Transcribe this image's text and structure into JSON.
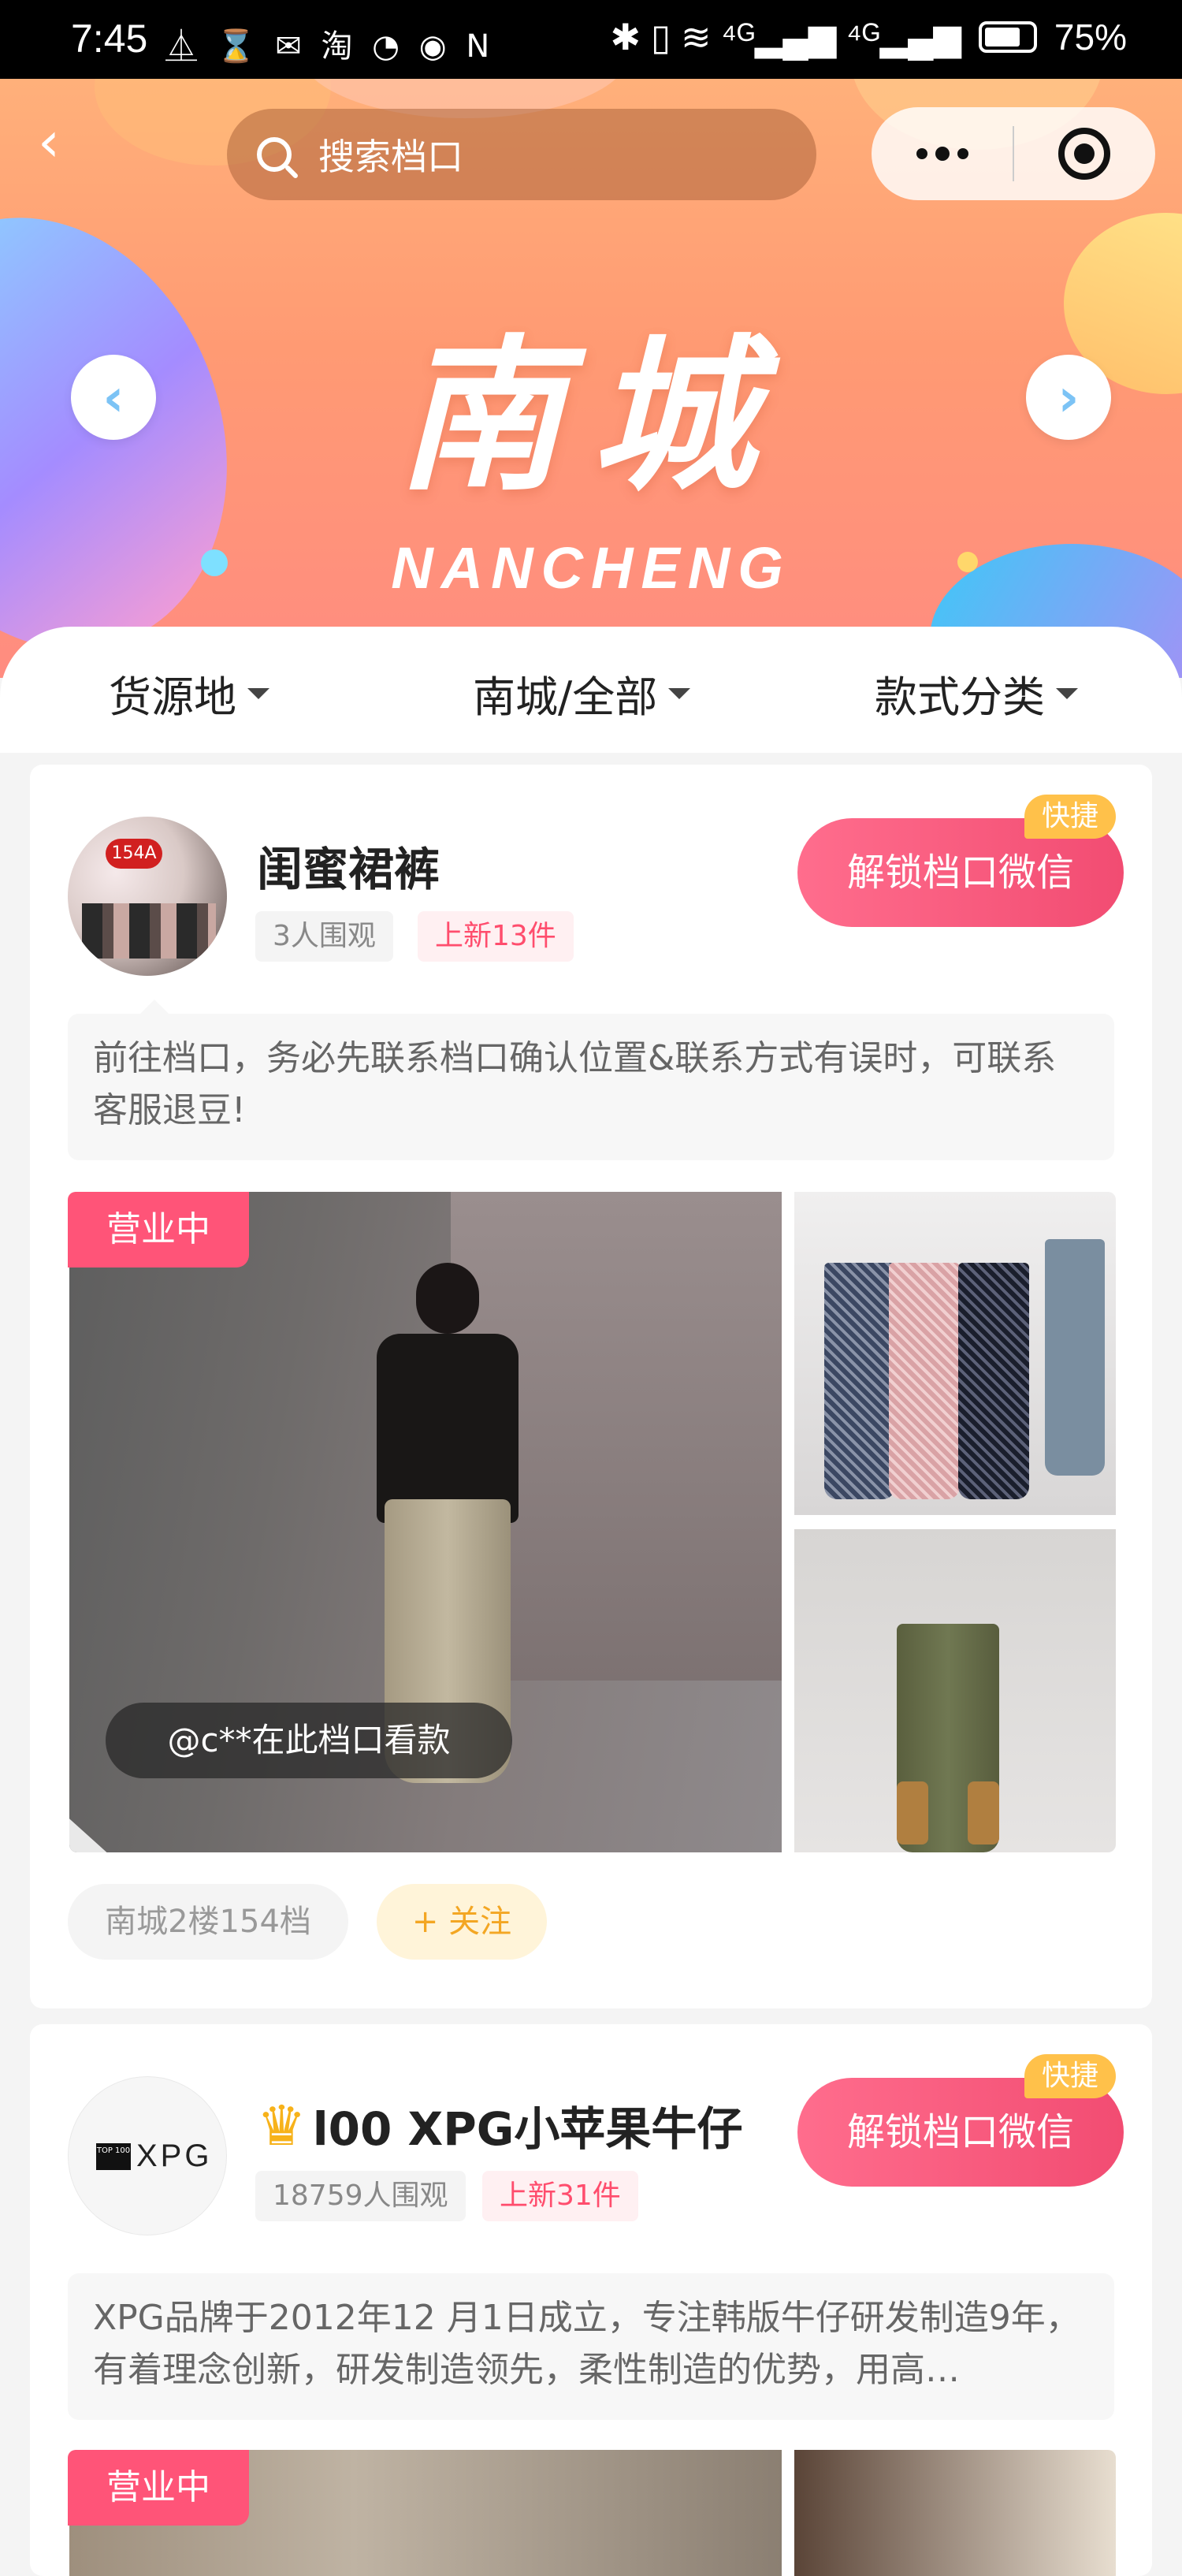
{
  "status_bar": {
    "time": "7:45",
    "notification_icons": "⏅ ⌛ ✉ 淘 ◔ ◉ N",
    "battery": "75%",
    "signal_text": "✱ ▯ ≋ ⁴ᴳ▂▄▆ ⁴ᴳ▂▄▆"
  },
  "header": {
    "back_icon": "‹",
    "search_placeholder": "搜索档口"
  },
  "banner": {
    "title": "南城",
    "subtitle": "NANCHENG",
    "prev_icon": "‹",
    "next_icon": "›"
  },
  "filters": [
    {
      "label": "货源地"
    },
    {
      "label": "南城/全部"
    },
    {
      "label": "款式分类"
    }
  ],
  "shops": [
    {
      "name": "闺蜜裙裤",
      "views": "3人围观",
      "new_items": "上新13件",
      "unlock_label": "解锁档口微信",
      "quick_label": "快捷",
      "notice": "前往档口，务必先联系档口确认位置&联系方式有误时，可联系客服退豆!",
      "status": "营业中",
      "viewer_note": "@c**在此档口看款",
      "avatar_tag": "154A",
      "location": "南城2楼154档",
      "follow_label": "+ 关注"
    },
    {
      "name": "l00 XPG小苹果牛仔",
      "views": "18759人围观",
      "new_items": "上新31件",
      "unlock_label": "解锁档口微信",
      "quick_label": "快捷",
      "notice": "XPG品牌于2012年12 月1日成立，专注韩版牛仔研发制造9年，有着理念创新，研发制造领先，柔性制造的优势，用高…",
      "status": "营业中",
      "avatar_logo_box": "TOP 100",
      "avatar_logo_text": "XPG"
    }
  ],
  "colors": {
    "accent_pink": "#f24c72",
    "quick_orange": "#ffc14a",
    "follow_orange": "#f3a623"
  }
}
